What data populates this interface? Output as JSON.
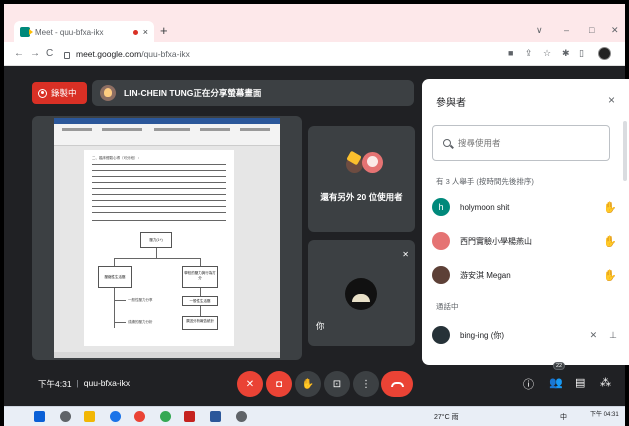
{
  "browser": {
    "tab_title": "Meet - quu-bfxa-ikx",
    "tab_close": "×",
    "new_tab": "+",
    "url_host": "meet.google.com",
    "url_path": "/quu-bfxa-ikx",
    "window_controls": [
      "∨",
      "–",
      "□",
      "✕"
    ]
  },
  "meet": {
    "recording_label": "錄製中",
    "presenter_text": "LIN-CHEIN TUNG正在分享螢幕畫面",
    "others_label": "還有另外 20 位使用者",
    "you_label": "你"
  },
  "doc": {
    "heading": "二、臨床經驗心得（可分段）：",
    "boxes": [
      "壓力(1+)",
      "壓縮性生活壓",
      "學校的壓力與行為打\n分",
      "一般性壓力分享",
      "成績的壓力分析",
      "一般性生活壓",
      "原因分析報告統計"
    ]
  },
  "participants": {
    "title": "參與者",
    "close": "×",
    "search_placeholder": "搜尋使用者",
    "raised_section": "有 3 人舉手 (按時間先後排序)",
    "in_call_section": "通話中",
    "items": [
      {
        "initial": "h",
        "name": "holymoon shit",
        "color": "#00897b"
      },
      {
        "initial": "",
        "name": "西門實驗小學楊燕山",
        "color": "#e57373"
      },
      {
        "initial": "",
        "name": "游安淇 Megan",
        "color": "#5d4037"
      },
      {
        "initial": "",
        "name": "bing-ing (你)",
        "color": "#263238"
      }
    ]
  },
  "bottom": {
    "time": "下午4:31",
    "separator": "|",
    "meeting_code": "quu-bfxa-ikx",
    "participants_count": "22"
  },
  "taskbar": {
    "weather": "27°C 雨",
    "ime": "中",
    "clock": "下午 04:31"
  },
  "colors": {
    "meet_bg": "#202124",
    "tile_bg": "#3c4043",
    "danger_red": "#ea4335",
    "tab_strip": "#fde8ea"
  }
}
